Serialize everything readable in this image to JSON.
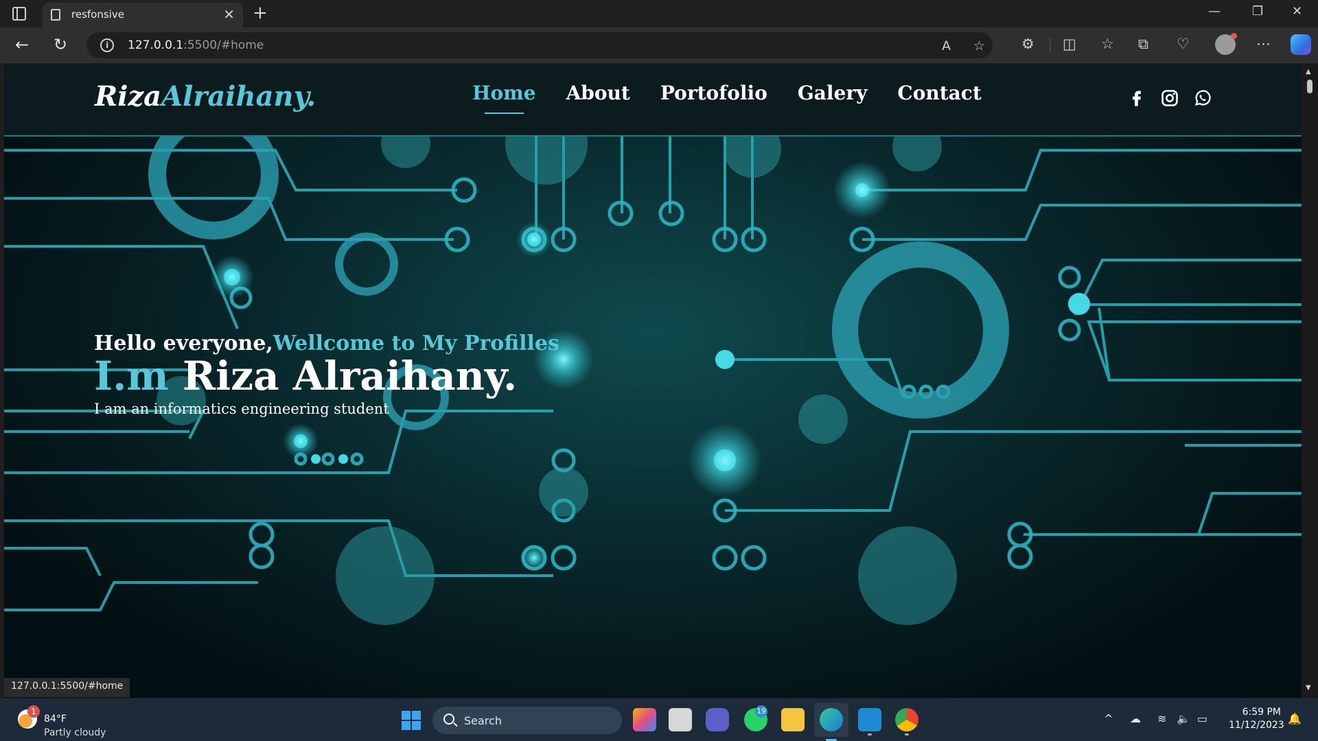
{
  "browser": {
    "tab_title": "resfonsive",
    "tab_close": "✕",
    "new_tab": "+",
    "url_host": "127.0.0.1",
    "url_rest": ":5500/#home",
    "status_url": "127.0.0.1:5500/#home"
  },
  "site": {
    "logo_main": "Riza",
    "logo_accent": "Alraihany.",
    "nav": [
      {
        "label": "Home",
        "active": true
      },
      {
        "label": "About",
        "active": false
      },
      {
        "label": "Portofolio",
        "active": false
      },
      {
        "label": "Galery",
        "active": false
      },
      {
        "label": "Contact",
        "active": false
      }
    ],
    "socials": [
      "facebook-icon",
      "instagram-icon",
      "whatsapp-icon"
    ],
    "accent_color": "#56c8d8"
  },
  "hero": {
    "greet_main": "Hello everyone,",
    "greet_accent": "Wellcome to My Profilles",
    "name_accent": "I.m",
    "name_main": " Riza Alraihany.",
    "subtitle": "I am an informatics engineering student"
  },
  "taskbar": {
    "weather_badge": "1",
    "weather_temp": "84°F",
    "weather_cond": "Partly cloudy",
    "search_label": "Search",
    "whatsapp_badge": "19",
    "time": "6:59 PM",
    "date": "11/12/2023"
  }
}
